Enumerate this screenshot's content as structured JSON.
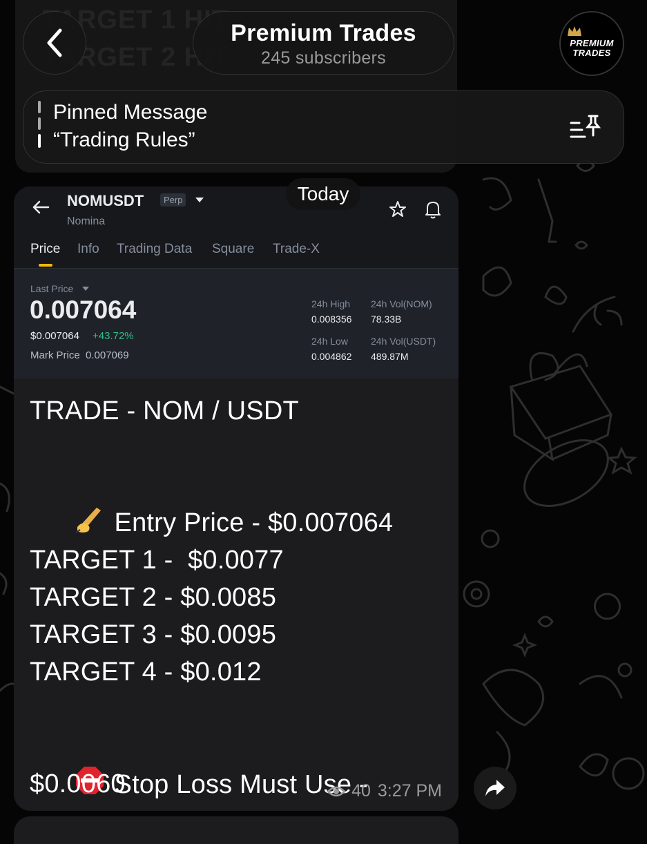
{
  "header": {
    "back_icon": "chevron-left-icon",
    "channel_name": "Premium Trades",
    "subscribers": "245 subscribers",
    "avatar_text": "PREMIUM TRADES"
  },
  "background": {
    "ghost_line_1": "TARGET 1 HIT",
    "ghost_line_2": "TARGET 2 HIT"
  },
  "pinned": {
    "title": "Pinned Message",
    "text": "“Trading Rules”",
    "icon": "pin-list-icon"
  },
  "date_chip": "Today",
  "screenshot": {
    "pair": "NOMUSDT",
    "tag": "Perp",
    "name": "Nomina",
    "tabs": [
      "Price",
      "Info",
      "Trading Data",
      "Square",
      "Trade-X"
    ],
    "active_tab": "Price",
    "last_price_label": "Last Price",
    "last_price": "0.007064",
    "usd_price": "$0.007064",
    "change": "+43.72%",
    "mark_price_label": "Mark Price",
    "mark_price": "0.007069",
    "stats": {
      "high_label": "24h High",
      "high": "0.008356",
      "vol_nom_label": "24h Vol(NOM)",
      "vol_nom": "78.33B",
      "low_label": "24h Low",
      "low": "0.004862",
      "vol_usdt_label": "24h Vol(USDT)",
      "vol_usdt": "489.87M"
    },
    "colors": {
      "accent": "#f0b90b",
      "positive": "#2ebd85"
    }
  },
  "message": {
    "trade": "TRADE - NOM / USDT",
    "entry": "Entry Price - $0.007064",
    "entry_emoji": "writing-hand",
    "target_1": "TARGET 1 -  $0.0077",
    "target_2": "TARGET 2 - $0.0085",
    "target_3": "TARGET 3 - $0.0095",
    "target_4": "TARGET 4 - $0.012",
    "stop_line_1": "Stop Loss Must Use -",
    "stop_line_2": "$0.0060",
    "stop_emoji": "stop-sign",
    "views": "40",
    "time": "3:27 PM"
  },
  "forward_icon": "share-arrow-icon"
}
